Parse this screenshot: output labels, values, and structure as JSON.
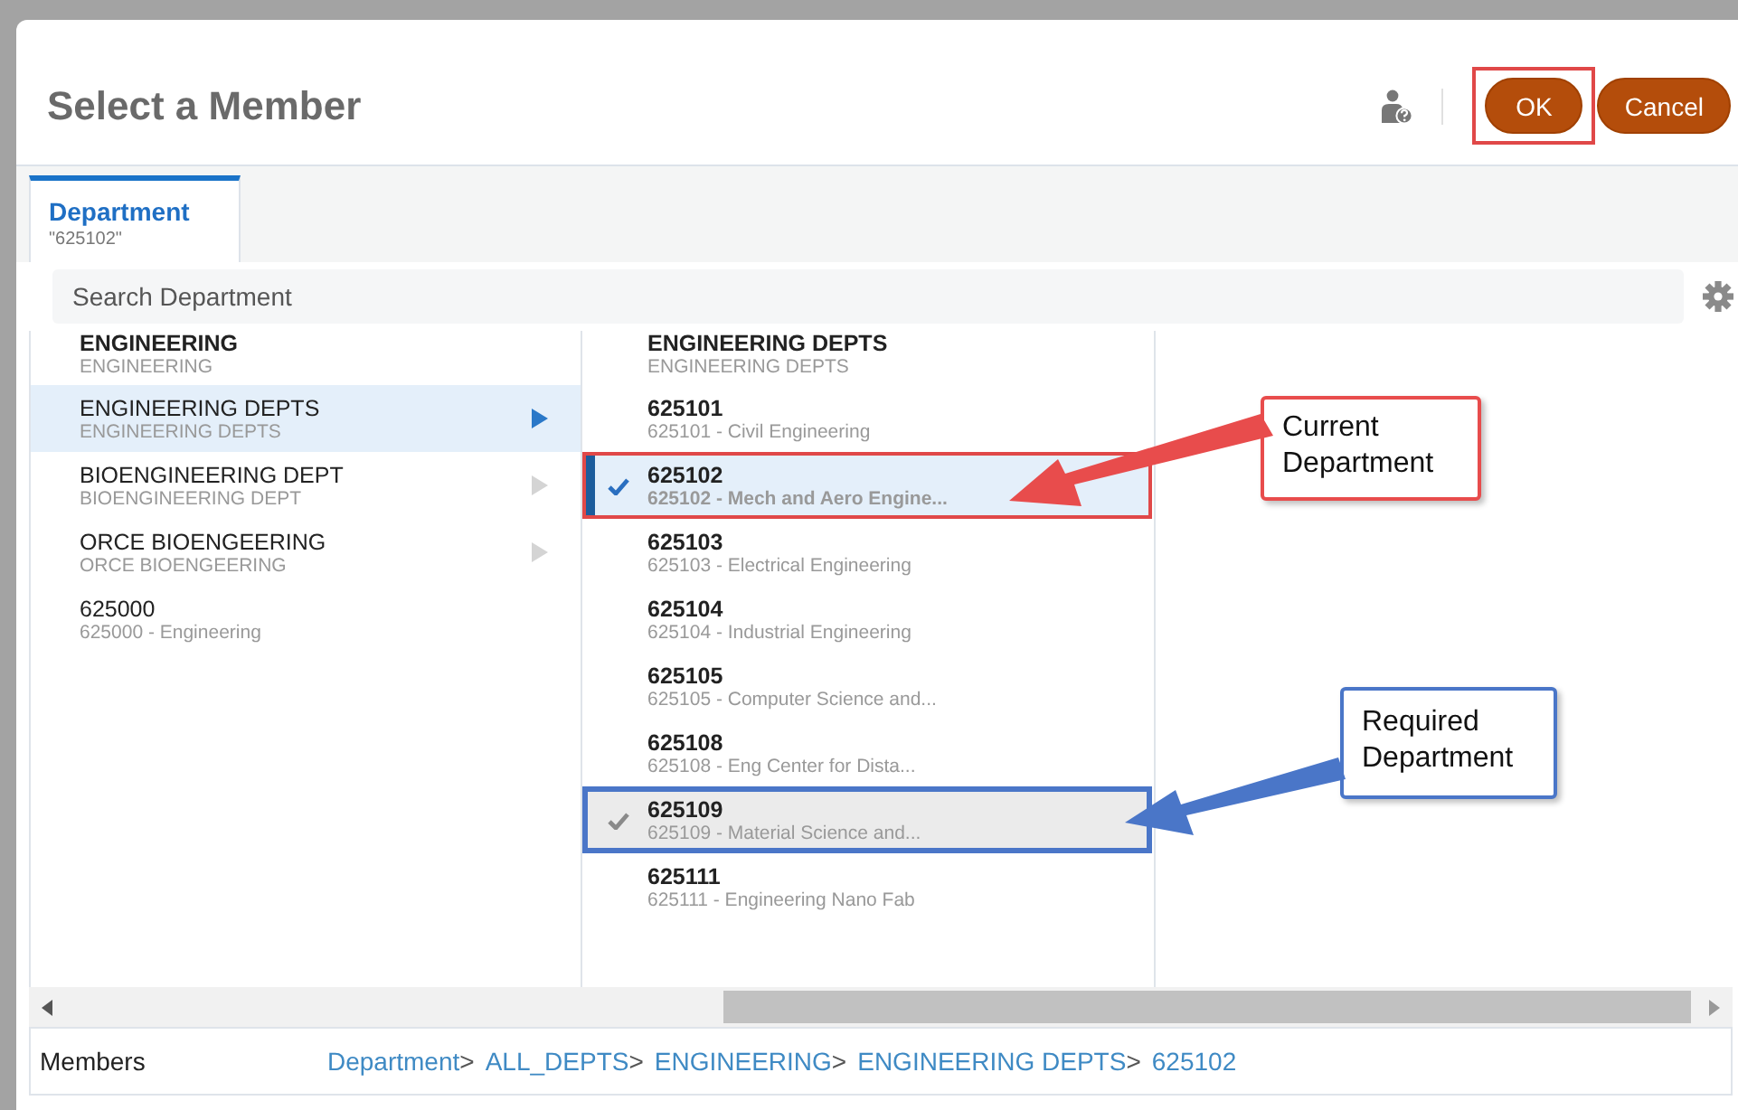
{
  "dialog": {
    "title": "Select a Member",
    "buttons": [
      {
        "label": "OK",
        "primary": true,
        "color": "#e04848"
      },
      {
        "label": "Cancel",
        "primary": false
      }
    ]
  },
  "tabs": [
    {
      "label": "Department",
      "value": "\"625102\"",
      "selected": true
    }
  ],
  "search": {
    "placeholder": "Search Department"
  },
  "columns": [
    {
      "header": {
        "name": "ENGINEERING",
        "description": "ENGINEERING"
      },
      "rows": [
        {
          "name": "ENGINEERING DEPTS",
          "description": "ENGINEERING DEPTS",
          "selected": true,
          "has_children": true
        },
        {
          "name": "BIOENGINEERING DEPT",
          "description": "BIOENGINEERING DEPT",
          "selected": false,
          "has_children": true
        },
        {
          "name": "ORCE BIOENGEERING",
          "description": "ORCE BIOENGEERING",
          "selected": false,
          "has_children": true
        },
        {
          "name": "625000",
          "description": "625000 - Engineering",
          "selected": false,
          "has_children": false
        }
      ]
    },
    {
      "header": {
        "name": "ENGINEERING DEPTS",
        "description": "ENGINEERING DEPTS"
      },
      "rows": [
        {
          "name": "625101",
          "description": "625101 - Civil Engineering",
          "selected": false,
          "checked": false,
          "hovered": false
        },
        {
          "name": "625102",
          "description": "625102 - Mech and Aero Engine...",
          "selected": true,
          "checked": true,
          "hovered": false,
          "color": "#e04848"
        },
        {
          "name": "625103",
          "description": "625103 - Electrical Engineering",
          "selected": false,
          "checked": false,
          "hovered": false
        },
        {
          "name": "625104",
          "description": "625104 - Industrial Engineering",
          "selected": false,
          "checked": false,
          "hovered": false
        },
        {
          "name": "625105",
          "description": "625105 - Computer Science and...",
          "selected": false,
          "checked": false,
          "hovered": false
        },
        {
          "name": "625108",
          "description": "625108 - Eng Center for Dista...",
          "selected": false,
          "checked": false,
          "hovered": false
        },
        {
          "name": "625109",
          "description": "625109 - Material Science and...",
          "selected": false,
          "checked": true,
          "hovered": true,
          "color": "#4a76c8"
        },
        {
          "name": "625111",
          "description": "625111 - Engineering Nano Fab",
          "selected": false,
          "checked": false,
          "hovered": false
        }
      ]
    }
  ],
  "annotations": [
    {
      "text": "Current Department",
      "color": "#e84c4c"
    },
    {
      "text": "Required Department",
      "color": "#4a76c8"
    }
  ],
  "footer": {
    "label": "Members",
    "separator": ">",
    "breadcrumb": [
      "Department",
      "ALL_DEPTS",
      "ENGINEERING",
      "ENGINEERING DEPTS",
      "625102"
    ]
  }
}
